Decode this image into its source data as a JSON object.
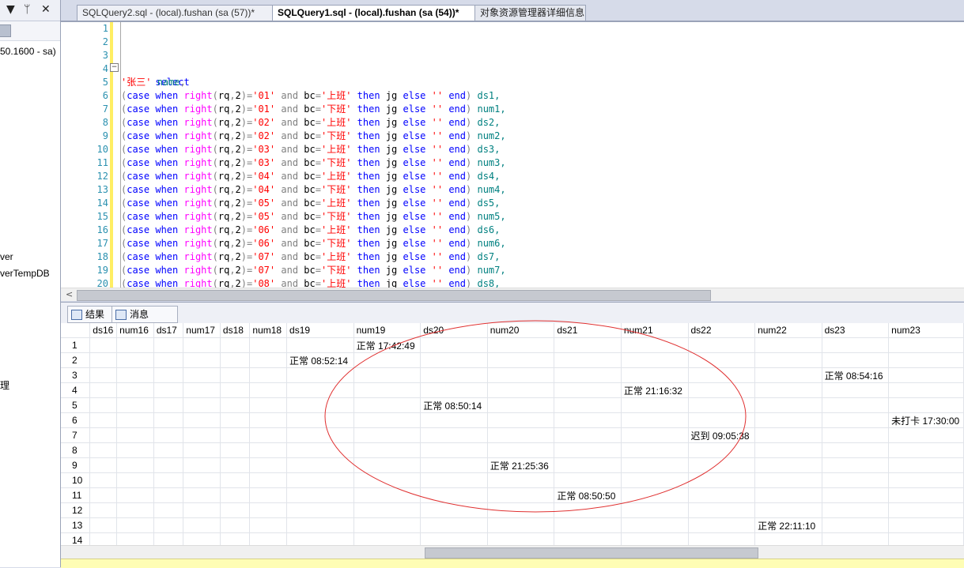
{
  "left_pane": {
    "controls": [
      "▼",
      "ᛘ",
      "✕"
    ],
    "lines": [
      "50.1600 - sa)",
      "ver",
      "verTempDB",
      "理"
    ]
  },
  "tabs": [
    {
      "label": "SQLQuery2.sql - (local).fushan (sa (57))*"
    },
    {
      "label": "SQLQuery1.sql - (local).fushan (sa (54))*"
    },
    {
      "label": "对象资源管理器详细信息"
    }
  ],
  "editor": {
    "line_numbers": [
      "1",
      "2",
      "3",
      "4",
      "5",
      "6",
      "7",
      "8",
      "9",
      "10",
      "11",
      "12",
      "13",
      "14",
      "15",
      "16",
      "17",
      "18",
      "19",
      "20"
    ],
    "select_kw": "select",
    "name_line": {
      "str": "'张三'",
      "alias": "name"
    },
    "case_lines": [
      {
        "rq": "'01'",
        "bc": "'上班'",
        "alias": "ds1,"
      },
      {
        "rq": "'01'",
        "bc": "'下班'",
        "alias": "num1,"
      },
      {
        "rq": "'02'",
        "bc": "'上班'",
        "alias": "ds2,"
      },
      {
        "rq": "'02'",
        "bc": "'下班'",
        "alias": "num2,"
      },
      {
        "rq": "'03'",
        "bc": "'上班'",
        "alias": "ds3,"
      },
      {
        "rq": "'03'",
        "bc": "'下班'",
        "alias": "num3,"
      },
      {
        "rq": "'04'",
        "bc": "'上班'",
        "alias": "ds4,"
      },
      {
        "rq": "'04'",
        "bc": "'下班'",
        "alias": "num4,"
      },
      {
        "rq": "'05'",
        "bc": "'上班'",
        "alias": "ds5,"
      },
      {
        "rq": "'05'",
        "bc": "'下班'",
        "alias": "num5,"
      },
      {
        "rq": "'06'",
        "bc": "'上班'",
        "alias": "ds6,"
      },
      {
        "rq": "'06'",
        "bc": "'下班'",
        "alias": "num6,"
      },
      {
        "rq": "'07'",
        "bc": "'上班'",
        "alias": "ds7,"
      },
      {
        "rq": "'07'",
        "bc": "'下班'",
        "alias": "num7,"
      },
      {
        "rq": "'08'",
        "bc": "'上班'",
        "alias": "ds8,"
      }
    ]
  },
  "result_tabs": [
    {
      "label": "结果"
    },
    {
      "label": "消息"
    }
  ],
  "grid": {
    "columns": [
      "",
      "ds16",
      "num16",
      "ds17",
      "num17",
      "ds18",
      "num18",
      "ds19",
      "num19",
      "ds20",
      "num20",
      "ds21",
      "num21",
      "ds22",
      "num22",
      "ds23",
      "num23"
    ],
    "rows": [
      [
        "1",
        "",
        "",
        "",
        "",
        "",
        "",
        "",
        "正常 17:42:49",
        "",
        "",
        "",
        "",
        "",
        "",
        "",
        ""
      ],
      [
        "2",
        "",
        "",
        "",
        "",
        "",
        "",
        "正常 08:52:14",
        "",
        "",
        "",
        "",
        "",
        "",
        "",
        "",
        ""
      ],
      [
        "3",
        "",
        "",
        "",
        "",
        "",
        "",
        "",
        "",
        "",
        "",
        "",
        "",
        "",
        "",
        "正常 08:54:16",
        ""
      ],
      [
        "4",
        "",
        "",
        "",
        "",
        "",
        "",
        "",
        "",
        "",
        "",
        "",
        "正常 21:16:32",
        "",
        "",
        "",
        ""
      ],
      [
        "5",
        "",
        "",
        "",
        "",
        "",
        "",
        "",
        "",
        "正常 08:50:14",
        "",
        "",
        "",
        "",
        "",
        "",
        ""
      ],
      [
        "6",
        "",
        "",
        "",
        "",
        "",
        "",
        "",
        "",
        "",
        "",
        "",
        "",
        "",
        "",
        "",
        "未打卡 17:30:00"
      ],
      [
        "7",
        "",
        "",
        "",
        "",
        "",
        "",
        "",
        "",
        "",
        "",
        "",
        "",
        "迟到 09:05:38",
        "",
        "",
        ""
      ],
      [
        "8",
        "",
        "",
        "",
        "",
        "",
        "",
        "",
        "",
        "",
        "",
        "",
        "",
        "",
        "",
        "",
        ""
      ],
      [
        "9",
        "",
        "",
        "",
        "",
        "",
        "",
        "",
        "",
        "",
        "正常 21:25:36",
        "",
        "",
        "",
        "",
        "",
        ""
      ],
      [
        "10",
        "",
        "",
        "",
        "",
        "",
        "",
        "",
        "",
        "",
        "",
        "",
        "",
        "",
        "",
        "",
        ""
      ],
      [
        "11",
        "",
        "",
        "",
        "",
        "",
        "",
        "",
        "",
        "",
        "",
        "正常 08:50:50",
        "",
        "",
        "",
        "",
        ""
      ],
      [
        "12",
        "",
        "",
        "",
        "",
        "",
        "",
        "",
        "",
        "",
        "",
        "",
        "",
        "",
        "",
        "",
        ""
      ],
      [
        "13",
        "",
        "",
        "",
        "",
        "",
        "",
        "",
        "",
        "",
        "",
        "",
        "",
        "",
        "正常 22:11:10",
        "",
        ""
      ],
      [
        "14",
        "",
        "",
        "",
        "",
        "",
        "",
        "",
        "",
        "",
        "",
        "",
        "",
        "",
        "",
        "",
        ""
      ]
    ]
  },
  "annotation": {
    "color": "#e03030"
  }
}
